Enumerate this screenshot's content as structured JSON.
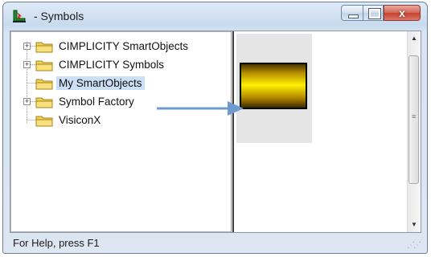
{
  "window": {
    "title": "- Symbols",
    "app_icon": "symbol-app-icon",
    "caption_buttons": {
      "minimize_icon": "minimize-icon",
      "maximize_icon": "maximize-icon",
      "close_glyph": "x"
    }
  },
  "tree": {
    "items": [
      {
        "label": "CIMPLICITY SmartObjects",
        "expandable": true,
        "selected": false
      },
      {
        "label": "CIMPLICITY Symbols",
        "expandable": true,
        "selected": false
      },
      {
        "label": "My SmartObjects",
        "expandable": false,
        "selected": true
      },
      {
        "label": "Symbol Factory",
        "expandable": true,
        "selected": false
      },
      {
        "label": "VisiconX",
        "expandable": false,
        "selected": false
      }
    ],
    "expander_glyph": "+"
  },
  "scrollbar": {
    "up_glyph": "▲",
    "down_glyph": "▼",
    "grip_glyph": "≡"
  },
  "status": {
    "text": "For Help, press F1"
  },
  "colors": {
    "selection": "#cbe0f5",
    "arrow": "#6d9bd0",
    "symbol_gold": "#fff000",
    "symbol_dark": "#3a2a00"
  }
}
